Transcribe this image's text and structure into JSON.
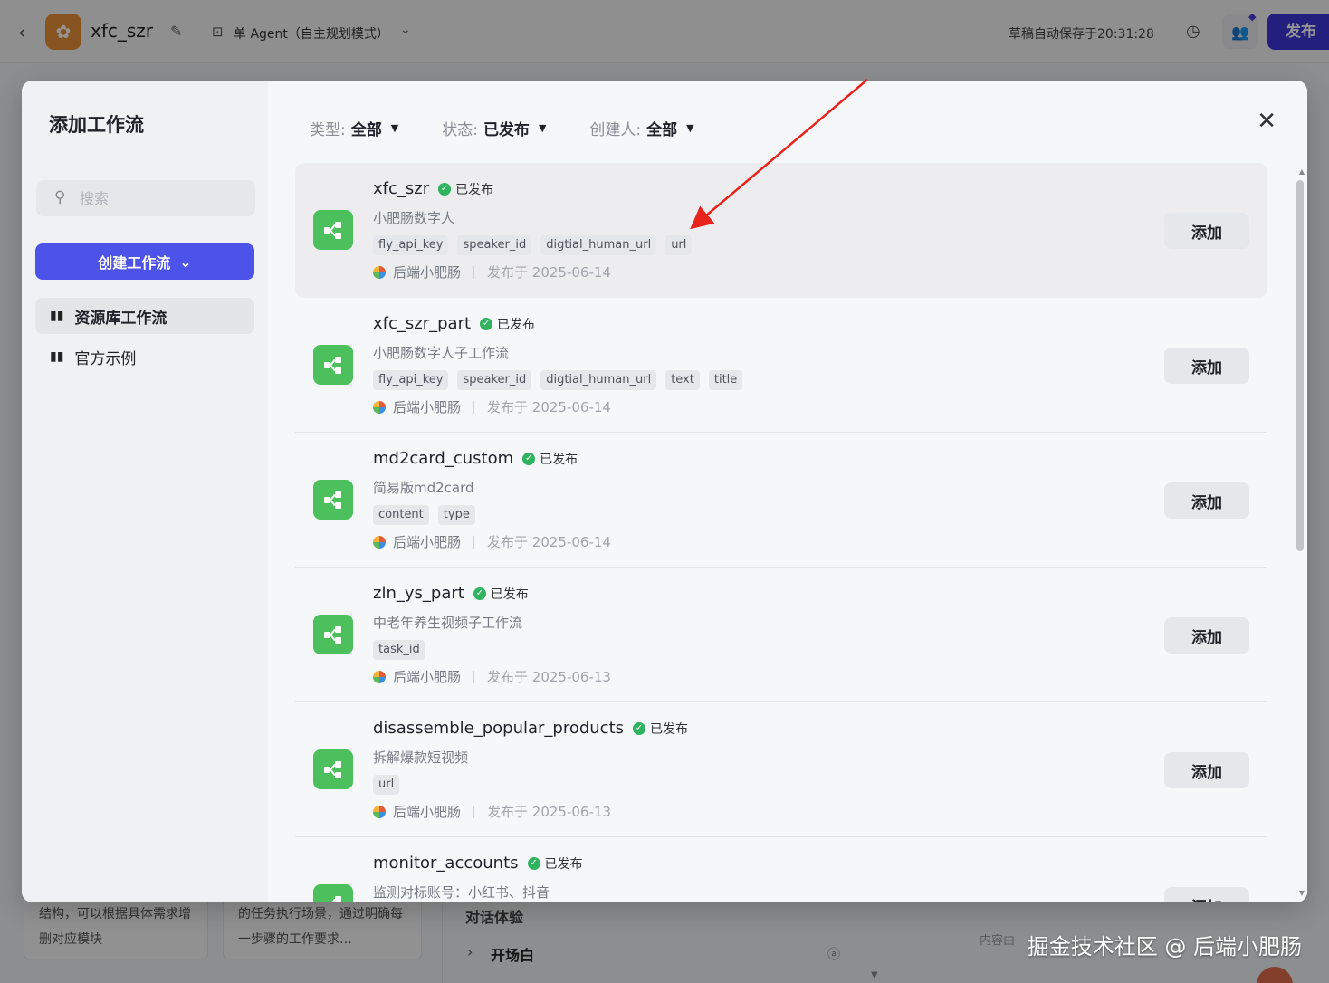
{
  "header": {
    "app_name": "xfc_szr",
    "mode_label": "单 Agent（自主规划模式）",
    "autosave": "草稿自动保存于20:31:28",
    "publish_label": "发布"
  },
  "background": {
    "card1_text": "结构，可以根据具体需求增删对应模块",
    "card2_text": "的任务执行场景，通过明确每一步骤的工作要求…",
    "section_title": "对话体验",
    "opening_label": "开场白",
    "hint_text": "内容由"
  },
  "modal": {
    "title": "添加工作流",
    "search_placeholder": "搜索",
    "create_label": "创建工作流",
    "nav": [
      {
        "label": "资源库工作流",
        "active": true
      },
      {
        "label": "官方示例",
        "active": false
      }
    ],
    "filters": [
      {
        "label": "类型:",
        "value": "全部"
      },
      {
        "label": "状态:",
        "value": "已发布"
      },
      {
        "label": "创建人:",
        "value": "全部"
      }
    ],
    "add_label": "添加",
    "status_label": "已发布",
    "author": "后端小肥肠",
    "workflows": [
      {
        "name": "xfc_szr",
        "desc": "小肥肠数字人",
        "tags": [
          "fly_api_key",
          "speaker_id",
          "digtial_human_url",
          "url"
        ],
        "date": "发布于 2025-06-14"
      },
      {
        "name": "xfc_szr_part",
        "desc": "小肥肠数字人子工作流",
        "tags": [
          "fly_api_key",
          "speaker_id",
          "digtial_human_url",
          "text",
          "title"
        ],
        "date": "发布于 2025-06-14"
      },
      {
        "name": "md2card_custom",
        "desc": "简易版md2card",
        "tags": [
          "content",
          "type"
        ],
        "date": "发布于 2025-06-14"
      },
      {
        "name": "zln_ys_part",
        "desc": "中老年养生视频子工作流",
        "tags": [
          "task_id"
        ],
        "date": "发布于 2025-06-13"
      },
      {
        "name": "disassemble_popular_products",
        "desc": "拆解爆款短视频",
        "tags": [
          "url"
        ],
        "date": "发布于 2025-06-13"
      },
      {
        "name": "monitor_accounts",
        "desc": "监测对标账号：小红书、抖音",
        "tags": [],
        "date": ""
      }
    ]
  },
  "watermark": "掘金技术社区 @ 后端小肥肠",
  "colors": {
    "primary": "#4d53e8",
    "publish": "#3b36d9",
    "workflow_icon": "#4bc05c",
    "published_check": "#2fb35e",
    "annotation_arrow": "#e8231b"
  }
}
